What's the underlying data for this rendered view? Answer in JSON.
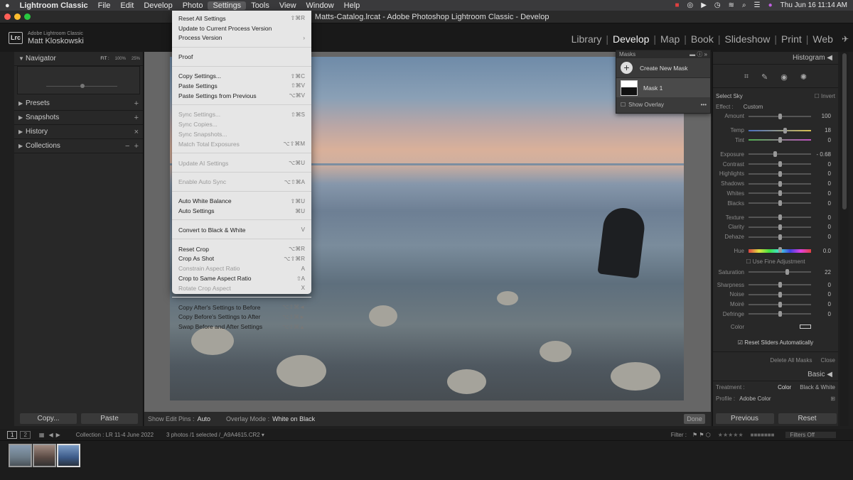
{
  "macmenu": {
    "apple": "",
    "app": "Lightroom Classic",
    "items": [
      "File",
      "Edit",
      "Develop",
      "Photo",
      "Settings",
      "Tools",
      "View",
      "Window",
      "Help"
    ],
    "datetime": "Thu Jun 16  11:14 AM"
  },
  "window_title": "Matts-Catalog.lrcat - Adobe Photoshop Lightroom Classic - Develop",
  "identity": {
    "logo": "Lrc",
    "product": "Adobe Lightroom Classic",
    "user": "Matt Kloskowski"
  },
  "modules": [
    "Library",
    "Develop",
    "Map",
    "Book",
    "Slideshow",
    "Print",
    "Web"
  ],
  "left": {
    "navigator": "Navigator",
    "nav_fit": "FIT :",
    "nav_100": "100%",
    "nav_25": "25%",
    "presets": "Presets",
    "snapshots": "Snapshots",
    "history": "History",
    "collections": "Collections",
    "copy": "Copy...",
    "paste": "Paste"
  },
  "menu": {
    "groups": [
      [
        {
          "label": "Reset All Settings",
          "sc": "⇧⌘R"
        },
        {
          "label": "Update to Current Process Version",
          "sc": ""
        },
        {
          "label": "Process Version",
          "sc": "›"
        }
      ],
      [
        {
          "label": "Proof",
          "sc": ""
        }
      ],
      [
        {
          "label": "Copy Settings...",
          "sc": "⇧⌘C"
        },
        {
          "label": "Paste Settings",
          "sc": "⇧⌘V"
        },
        {
          "label": "Paste Settings from Previous",
          "sc": "⌥⌘V"
        }
      ],
      [
        {
          "label": "Sync Settings...",
          "sc": "⇧⌘S",
          "dis": true
        },
        {
          "label": "Sync Copies...",
          "sc": "",
          "dis": true
        },
        {
          "label": "Sync Snapshots...",
          "sc": "",
          "dis": true
        },
        {
          "label": "Match Total Exposures",
          "sc": "⌥⇧⌘M",
          "dis": true
        }
      ],
      [
        {
          "label": "Update AI Settings",
          "sc": "⌥⌘U",
          "dis": true
        }
      ],
      [
        {
          "label": "Enable Auto Sync",
          "sc": "⌥⇧⌘A",
          "dis": true
        }
      ],
      [
        {
          "label": "Auto White Balance",
          "sc": "⇧⌘U"
        },
        {
          "label": "Auto Settings",
          "sc": "⌘U"
        }
      ],
      [
        {
          "label": "Convert to Black & White",
          "sc": "V"
        }
      ],
      [
        {
          "label": "Reset Crop",
          "sc": "⌥⌘R"
        },
        {
          "label": "Crop As Shot",
          "sc": "⌥⇧⌘R"
        },
        {
          "label": "Constrain Aspect Ratio",
          "sc": "A",
          "dis": true
        },
        {
          "label": "Crop to Same Aspect Ratio",
          "sc": "⇧A"
        },
        {
          "label": "Rotate Crop Aspect",
          "sc": "X",
          "dis": true
        }
      ],
      [
        {
          "label": "Copy After's Settings to Before",
          "sc": "⌥⇧⌘◄"
        },
        {
          "label": "Copy Before's Settings to After",
          "sc": "⌥⇧⌘►"
        },
        {
          "label": "Swap Before and After Settings",
          "sc": "⌥⇧⌘▲"
        }
      ]
    ]
  },
  "masks": {
    "title": "Masks",
    "create": "Create New Mask",
    "mask1": "Mask 1",
    "overlay": "Show Overlay"
  },
  "right": {
    "histogram": "Histogram",
    "select_sky": "Select Sky",
    "invert": "Invert",
    "effect": "Effect :",
    "custom": "Custom",
    "sliders": [
      {
        "label": "Amount",
        "value": "100",
        "pos": 0.5
      },
      {
        "label": "Temp",
        "value": "18",
        "pos": 0.58,
        "temp": true
      },
      {
        "label": "Tint",
        "value": "0",
        "pos": 0.5,
        "tint": true
      },
      {
        "label": "Exposure",
        "value": "- 0.68",
        "pos": 0.42
      },
      {
        "label": "Contrast",
        "value": "0",
        "pos": 0.5
      },
      {
        "label": "Highlights",
        "value": "0",
        "pos": 0.5
      },
      {
        "label": "Shadows",
        "value": "0",
        "pos": 0.5
      },
      {
        "label": "Whites",
        "value": "0",
        "pos": 0.5
      },
      {
        "label": "Blacks",
        "value": "0",
        "pos": 0.5
      },
      {
        "label": "Texture",
        "value": "0",
        "pos": 0.5
      },
      {
        "label": "Clarity",
        "value": "0",
        "pos": 0.5
      },
      {
        "label": "Dehaze",
        "value": "0",
        "pos": 0.5
      },
      {
        "label": "Hue",
        "value": "0.0",
        "pos": 0.5,
        "hue": true
      }
    ],
    "fine": "Use Fine Adjustment",
    "saturation": {
      "label": "Saturation",
      "value": "22",
      "pos": 0.61
    },
    "sliders2": [
      {
        "label": "Sharpness",
        "value": "0",
        "pos": 0.5
      },
      {
        "label": "Noise",
        "value": "0",
        "pos": 0.5
      },
      {
        "label": "Moiré",
        "value": "0",
        "pos": 0.5
      },
      {
        "label": "Defringe",
        "value": "0",
        "pos": 0.5
      }
    ],
    "color": "Color",
    "reset_auto": "Reset Sliders Automatically",
    "delete_all": "Delete All Masks",
    "close": "Close",
    "basic": "Basic",
    "treatment": "Treatment :",
    "color_btn": "Color",
    "bw_btn": "Black & White",
    "profile": "Profile :",
    "profile_val": "Adobe Color",
    "previous": "Previous",
    "reset": "Reset"
  },
  "toolbar": {
    "show_pins": "Show Edit Pins :",
    "pins_val": "Auto",
    "overlay_mode": "Overlay Mode :",
    "overlay_val": "White on Black",
    "done": "Done"
  },
  "filmstrip": {
    "p1": "1",
    "p2": "2",
    "collection": "Collection : LR 11-4 June 2022",
    "count": "3 photos /1 selected /_A9A4615.CR2 ▾",
    "filter": "Filter :",
    "filters_off": "Filters Off"
  }
}
